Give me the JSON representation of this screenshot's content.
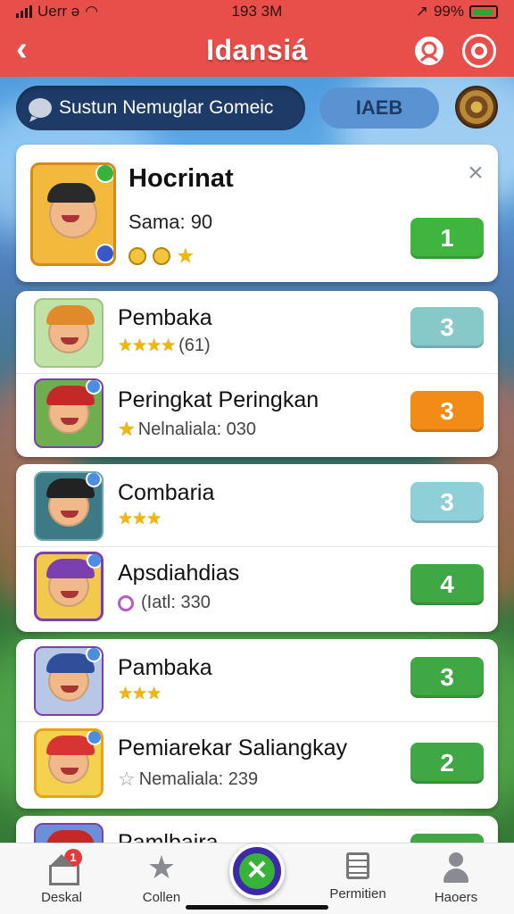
{
  "status_bar": {
    "carrier": "Uerr ə",
    "time": "193 3M",
    "battery": "99%"
  },
  "header": {
    "title": "Idansiá"
  },
  "search": {
    "text": "Sustun Nemuglar Gomeic",
    "filter_label": "IAEB"
  },
  "featured": {
    "name": "Hocrinat",
    "score": "Sama: 90",
    "rank": "1",
    "rank_color": "#3fb43f"
  },
  "list": [
    {
      "name": "Pembaka",
      "sub": "(61)",
      "sub_kind": "stars",
      "stars": "★★★★",
      "rank": "3",
      "rank_color": "#87c9c9",
      "bg": "#bfe2a6",
      "hat": "#e08a2c"
    },
    {
      "name": "Peringkat Peringkan",
      "sub": "Nelnaliala: 030",
      "sub_kind": "star-text",
      "stars": "★",
      "rank": "3",
      "rank_color": "#f28c17",
      "bg": "#6fae4e",
      "hat": "#c62828"
    },
    {
      "name": "Combaria",
      "sub": "",
      "sub_kind": "stars",
      "stars": "★★★",
      "rank": "3",
      "rank_color": "#8fcfd8",
      "bg": "#3e7a86",
      "hat": "#222222"
    },
    {
      "name": "Apsdiahdias",
      "sub": "(Iatl: 330",
      "sub_kind": "bubble",
      "stars": "",
      "rank": "4",
      "rank_color": "#3fa844",
      "bg": "#f2c94c",
      "hat": "#7b3fb0"
    },
    {
      "name": "Pambaka",
      "sub": "",
      "sub_kind": "stars",
      "stars": "★★★",
      "rank": "3",
      "rank_color": "#3fa844",
      "bg": "#b9c7e6",
      "hat": "#2f4f9a"
    },
    {
      "name": "Pemiarekar Saliangkay",
      "sub": "Nemaliala: 239",
      "sub_kind": "outline",
      "stars": "☆",
      "rank": "2",
      "rank_color": "#3fa844",
      "bg": "#f4d24e",
      "hat": "#d83434"
    },
    {
      "name": "Pamlbaira",
      "sub": "",
      "sub_kind": "",
      "stars": "",
      "rank": "",
      "rank_color": "#3fa844",
      "bg": "#6c8fd8",
      "hat": "#c62828"
    }
  ],
  "bottom_nav": {
    "home": "Deskal",
    "home_badge": "1",
    "collection": "Collen",
    "center_icon": "✕",
    "permissions": "Permitien",
    "heroes": "Haoers"
  },
  "colors": {
    "accent": "#e84e4a",
    "primary": "#3fb43f"
  }
}
